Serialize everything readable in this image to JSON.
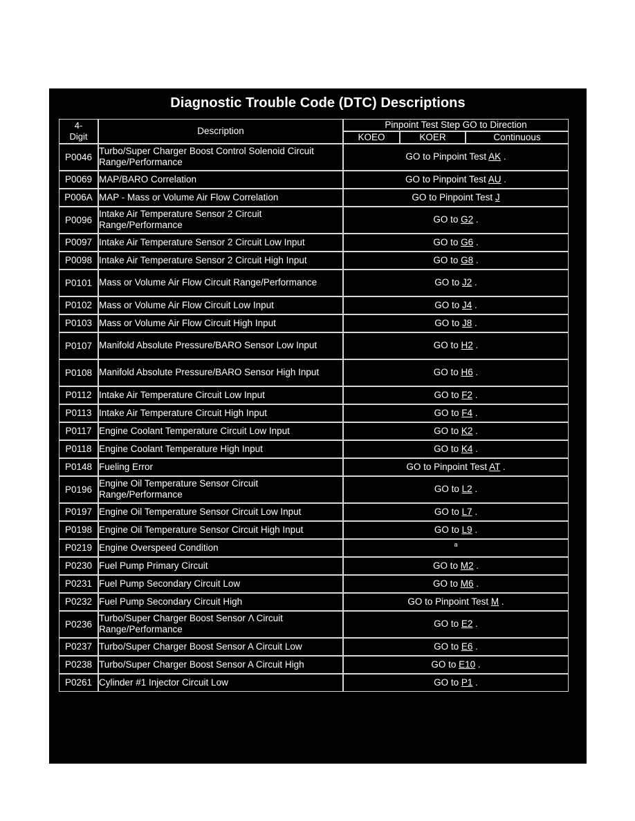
{
  "document": {
    "title": "Diagnostic Trouble Code (DTC) Descriptions"
  },
  "table": {
    "headers": {
      "code": "4-\nDigit",
      "code_line1": "4-",
      "code_line2": "Digit",
      "description": "Description",
      "group": "Pinpoint Test Step GO to Direction",
      "koeo": "KOEO",
      "koer": "KOER",
      "continuous": "Continuous"
    },
    "rows": [
      {
        "code": "P0046",
        "description": "Turbo/Super Charger Boost Control Solenoid Circuit Range/Performance",
        "action_prefix": "GO to Pinpoint Test ",
        "action_ref": "AK",
        "action_suffix": " .",
        "lines": 2
      },
      {
        "code": "P0069",
        "description": "MAP/BARO Correlation",
        "action_prefix": "GO to Pinpoint Test ",
        "action_ref": "AU",
        "action_suffix": " .",
        "lines": 1
      },
      {
        "code": "P006A",
        "description": "MAP - Mass or Volume Air Flow Correlation",
        "action_prefix": "GO to Pinpoint Test ",
        "action_ref": "J",
        "action_suffix": "",
        "lines": 1
      },
      {
        "code": "P0096",
        "description": "Intake Air Temperature Sensor 2 Circuit Range/Performance",
        "action_prefix": "GO to ",
        "action_ref": "G2",
        "action_suffix": " .",
        "lines": 2
      },
      {
        "code": "P0097",
        "description": "Intake Air Temperature Sensor 2 Circuit Low Input",
        "action_prefix": "GO to ",
        "action_ref": "G6",
        "action_suffix": " .",
        "lines": 1
      },
      {
        "code": "P0098",
        "description": "Intake Air Temperature Sensor 2 Circuit High Input",
        "action_prefix": "GO to ",
        "action_ref": "G8",
        "action_suffix": " .",
        "lines": 1
      },
      {
        "code": "P0101",
        "description": "Mass or Volume Air Flow Circuit Range/Performance",
        "action_prefix": "GO to ",
        "action_ref": "J2",
        "action_suffix": " .",
        "lines": 2
      },
      {
        "code": "P0102",
        "description": "Mass or Volume Air Flow Circuit Low Input",
        "action_prefix": "GO to ",
        "action_ref": "J4",
        "action_suffix": " .",
        "lines": 1
      },
      {
        "code": "P0103",
        "description": "Mass or Volume Air Flow Circuit High Input",
        "action_prefix": "GO to ",
        "action_ref": "J8",
        "action_suffix": " .",
        "lines": 1
      },
      {
        "code": "P0107",
        "description": "Manifold Absolute Pressure/BARO Sensor Low Input",
        "action_prefix": "GO to ",
        "action_ref": "H2",
        "action_suffix": " .",
        "lines": 2
      },
      {
        "code": "P0108",
        "description": "Manifold Absolute Pressure/BARO Sensor High Input",
        "action_prefix": "GO to ",
        "action_ref": "H6",
        "action_suffix": " .",
        "lines": 2
      },
      {
        "code": "P0112",
        "description": "Intake Air Temperature Circuit Low Input",
        "action_prefix": "GO to ",
        "action_ref": "F2",
        "action_suffix": " .",
        "lines": 1
      },
      {
        "code": "P0113",
        "description": "Intake Air Temperature Circuit High Input",
        "action_prefix": "GO to ",
        "action_ref": "F4",
        "action_suffix": " .",
        "lines": 1
      },
      {
        "code": "P0117",
        "description": "Engine Coolant Temperature Circuit Low Input",
        "action_prefix": "GO to ",
        "action_ref": "K2",
        "action_suffix": " .",
        "lines": 1
      },
      {
        "code": "P0118",
        "description": "Engine Coolant Temperature High Input",
        "action_prefix": "GO to ",
        "action_ref": "K4",
        "action_suffix": " .",
        "lines": 1
      },
      {
        "code": "P0148",
        "description": "Fueling Error",
        "action_prefix": "GO to Pinpoint Test ",
        "action_ref": "AT",
        "action_suffix": " .",
        "lines": 1
      },
      {
        "code": "P0196",
        "description": "Engine Oil Temperature Sensor Circuit Range/Performance",
        "action_prefix": "GO to ",
        "action_ref": "L2",
        "action_suffix": " .",
        "lines": 2
      },
      {
        "code": "P0197",
        "description": "Engine Oil Temperature Sensor Circuit Low Input",
        "action_prefix": "GO to ",
        "action_ref": "L7",
        "action_suffix": " .",
        "lines": 1
      },
      {
        "code": "P0198",
        "description": "Engine Oil Temperature Sensor Circuit High Input",
        "action_prefix": "GO to ",
        "action_ref": "L9",
        "action_suffix": " .",
        "lines": 1
      },
      {
        "code": "P0219",
        "description": "Engine Overspeed Condition",
        "action_prefix": "",
        "action_ref": "",
        "action_suffix": "",
        "action_footnote": "a",
        "lines": 1
      },
      {
        "code": "P0230",
        "description": "Fuel Pump Primary Circuit",
        "action_prefix": "GO to ",
        "action_ref": "M2",
        "action_suffix": " .",
        "lines": 1
      },
      {
        "code": "P0231",
        "description": "Fuel Pump Secondary Circuit Low",
        "action_prefix": "GO to ",
        "action_ref": "M6",
        "action_suffix": " .",
        "lines": 1
      },
      {
        "code": "P0232",
        "description": "Fuel Pump Secondary Circuit High",
        "action_prefix": "GO to Pinpoint Test ",
        "action_ref": "M",
        "action_suffix": " .",
        "lines": 1
      },
      {
        "code": "P0236",
        "description": "Turbo/Super Charger Boost Sensor Λ Circuit Range/Performance",
        "action_prefix": "GO to ",
        "action_ref": "E2",
        "action_suffix": " .",
        "lines": 2
      },
      {
        "code": "P0237",
        "description": "Turbo/Super Charger Boost Sensor A Circuit Low",
        "action_prefix": "GO to ",
        "action_ref": "E6",
        "action_suffix": " .",
        "lines": 1
      },
      {
        "code": "P0238",
        "description": "Turbo/Super Charger Boost Sensor A Circuit High",
        "action_prefix": "GO to ",
        "action_ref": "E10",
        "action_suffix": " .",
        "lines": 1
      },
      {
        "code": "P0261",
        "description": "Cylinder #1 Injector Circuit Low",
        "action_prefix": "GO to ",
        "action_ref": "P1",
        "action_suffix": " .",
        "lines": 1
      }
    ]
  },
  "colors": {
    "page_background": "#ffffff",
    "panel_background": "#000000",
    "text": "#ffffff",
    "border": "#d8d8d8"
  }
}
